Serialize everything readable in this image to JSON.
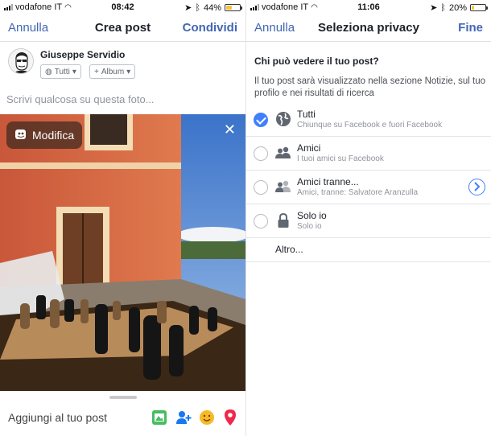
{
  "left_screen": {
    "status": {
      "carrier": "vodafone IT",
      "time": "08:42",
      "battery_percent": "44%",
      "battery_level": 0.44
    },
    "nav": {
      "cancel": "Annulla",
      "title": "Crea post",
      "share": "Condividi"
    },
    "author": {
      "name": "Giuseppe Servidio"
    },
    "pills": {
      "audience": "Tutti",
      "album": "Album"
    },
    "composer_placeholder": "Scrivi qualcosa su questa foto...",
    "photo": {
      "edit_label": "Modifica",
      "close_glyph": "✕"
    },
    "add_bar": {
      "label": "Aggiungi al tuo post",
      "icons": [
        "photo-icon",
        "tag-people-icon",
        "feeling-icon",
        "location-pin-icon"
      ]
    }
  },
  "right_screen": {
    "status": {
      "carrier": "vodafone IT",
      "time": "11:06",
      "battery_percent": "20%",
      "battery_level": 0.2
    },
    "nav": {
      "cancel": "Annulla",
      "title": "Seleziona privacy",
      "done": "Fine"
    },
    "question": "Chi può vedere il tuo post?",
    "description": "Il tuo post sarà visualizzato nella sezione Notizie, sul tuo profilo e nei risultati di ricerca",
    "options": [
      {
        "label": "Tutti",
        "sub": "Chiunque su Facebook e fuori Facebook",
        "icon": "globe-icon",
        "selected": true
      },
      {
        "label": "Amici",
        "sub": "I tuoi amici su Facebook",
        "icon": "friends-icon",
        "selected": false
      },
      {
        "label": "Amici tranne...",
        "sub": "Amici, tranne: Salvatore Aranzulla",
        "icon": "friends-except-icon",
        "selected": false
      },
      {
        "label": "Solo io",
        "sub": "Solo io",
        "icon": "lock-icon",
        "selected": false
      }
    ],
    "more": "Altro..."
  },
  "colors": {
    "fb_blue": "#4267b2",
    "selected_blue": "#4080ff",
    "battery_yellow": "#f5c542"
  }
}
